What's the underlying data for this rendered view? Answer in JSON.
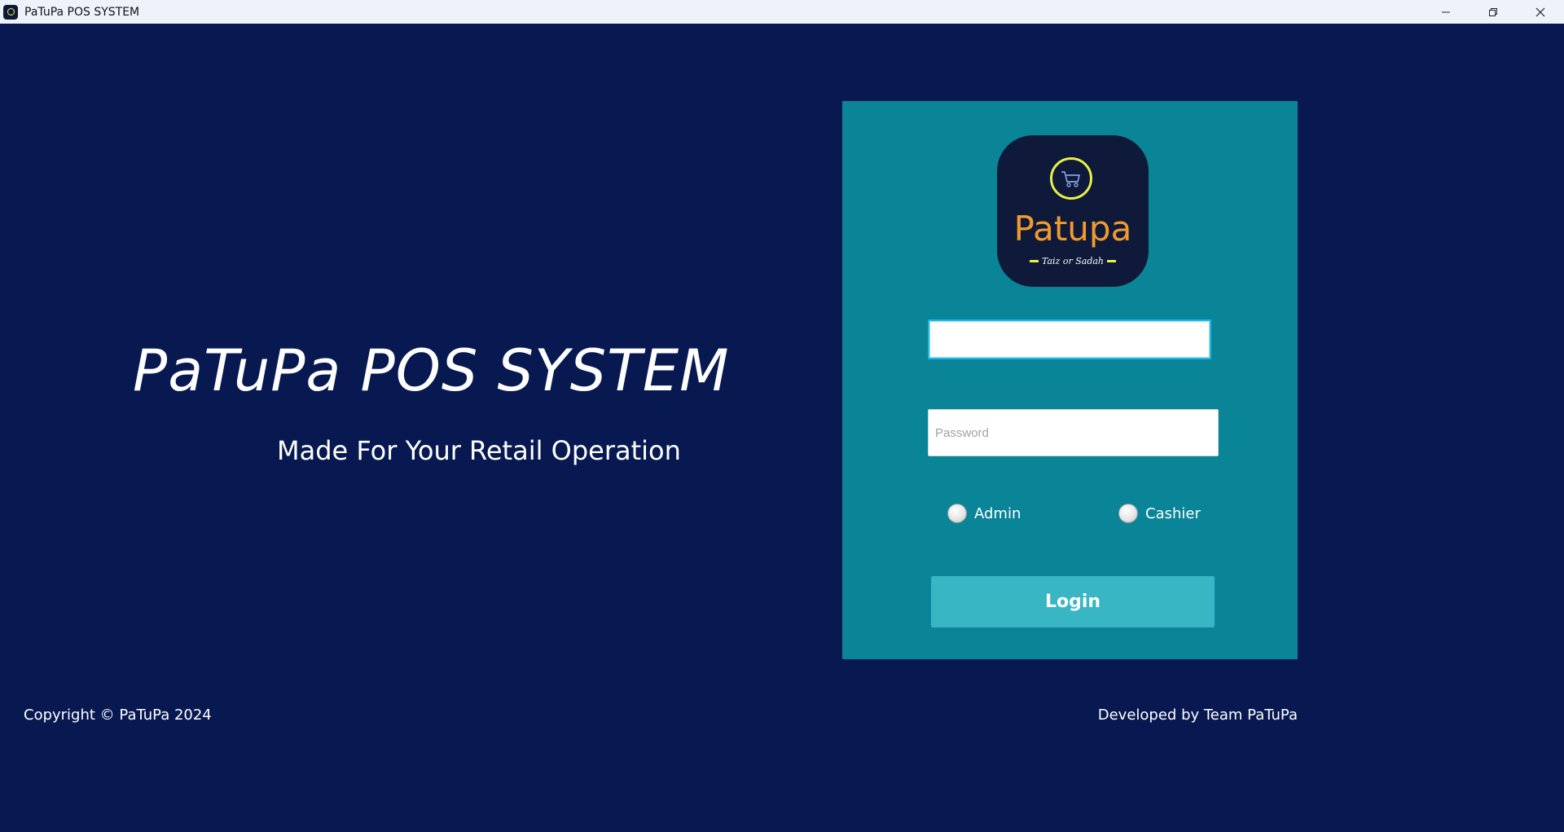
{
  "window": {
    "title": "PaTuPa POS SYSTEM",
    "controls": [
      "minimize-icon",
      "restore-icon",
      "close-icon"
    ]
  },
  "hero": {
    "title": "PaTuPa POS SYSTEM",
    "subtitle": "Made For Your Retail Operation"
  },
  "logo": {
    "brand": "Patupa",
    "tagline": "Taiz or Sadah",
    "icon": "shopping-cart-icon"
  },
  "login": {
    "username_value": "",
    "username_placeholder": "",
    "password_placeholder": "Password",
    "roles": [
      {
        "label": "Admin",
        "selected": false
      },
      {
        "label": "Cashier",
        "selected": false
      }
    ],
    "button_label": "Login"
  },
  "footer": {
    "copyright": "Copyright © PaTuPa 2024",
    "developer": "Developed by Team PaTuPa"
  },
  "colors": {
    "background": "#081951",
    "panel": "#0a8497",
    "button": "#38b6c4",
    "logo_bg": "#0f1a3a",
    "brand_orange": "#f29a2e",
    "accent_yellow": "#e8f04a"
  }
}
